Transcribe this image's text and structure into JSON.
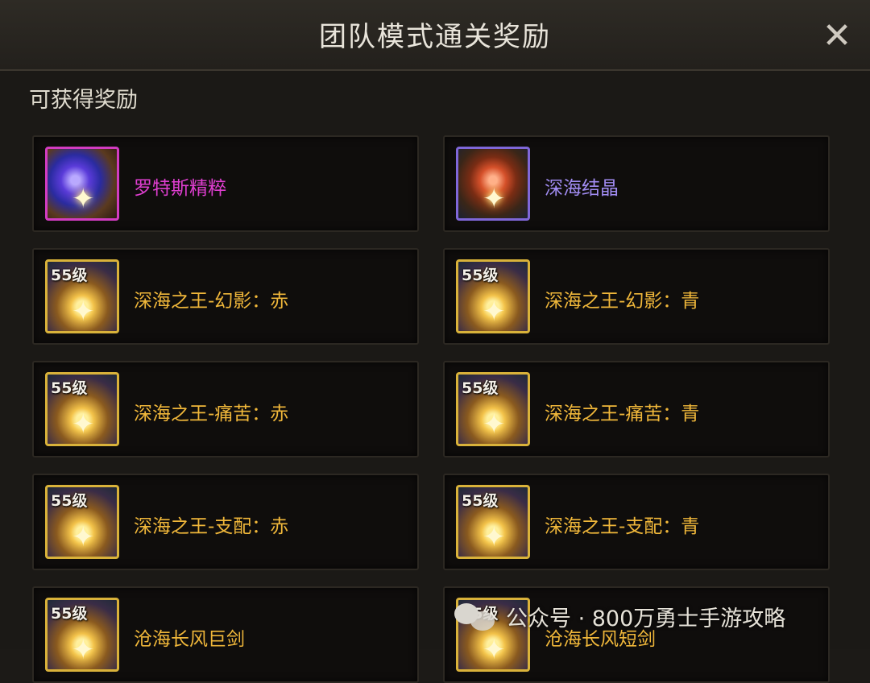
{
  "dialog": {
    "title": "团队模式通关奖励",
    "close_icon": "close-icon"
  },
  "section": {
    "label": "可获得奖励"
  },
  "rewards": [
    {
      "name": "罗特斯精粹",
      "level": "",
      "color": "magenta",
      "icon": "pink"
    },
    {
      "name": "深海结晶",
      "level": "",
      "color": "violet",
      "icon": "purple"
    },
    {
      "name": "深海之王-幻影：赤",
      "level": "55级",
      "color": "gold",
      "icon": "gold"
    },
    {
      "name": "深海之王-幻影：青",
      "level": "55级",
      "color": "gold",
      "icon": "gold"
    },
    {
      "name": "深海之王-痛苦：赤",
      "level": "55级",
      "color": "gold",
      "icon": "gold"
    },
    {
      "name": "深海之王-痛苦：青",
      "level": "55级",
      "color": "gold",
      "icon": "gold"
    },
    {
      "name": "深海之王-支配：赤",
      "level": "55级",
      "color": "gold",
      "icon": "gold"
    },
    {
      "name": "深海之王-支配：青",
      "level": "55级",
      "color": "gold",
      "icon": "gold"
    },
    {
      "name": "沧海长风巨剑",
      "level": "55级",
      "color": "gold",
      "icon": "gold"
    },
    {
      "name": "沧海长风短剑",
      "level": "55级",
      "color": "gold",
      "icon": "gold"
    }
  ],
  "watermark": {
    "text": "公众号 · 800万勇士手游攻略"
  },
  "colors": {
    "gold": "#f0b73a",
    "magenta": "#df3ed0",
    "violet": "#a18cf2"
  }
}
